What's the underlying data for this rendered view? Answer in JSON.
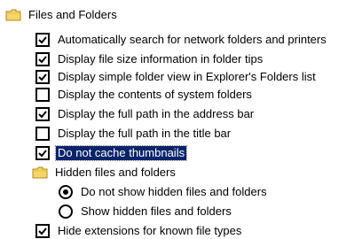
{
  "groups": [
    {
      "label": "Files and Folders",
      "icon": "folder-icon",
      "items": [
        {
          "label": "Automatically search for network folders and printers",
          "checked": true
        },
        {
          "label": "Display file size information in folder tips",
          "checked": true
        },
        {
          "label": "Display simple folder view in Explorer's Folders list",
          "checked": true
        },
        {
          "label": "Display the contents of system folders",
          "checked": false
        },
        {
          "label": "Display the full path in the address bar",
          "checked": true
        },
        {
          "label": "Display the full path in the title bar",
          "checked": false
        },
        {
          "label": "Do not cache thumbnails",
          "checked": true,
          "selected": true
        }
      ],
      "subgroup": {
        "label": "Hidden files and folders",
        "icon": "folder-icon",
        "options": [
          {
            "label": "Do not show hidden files and folders",
            "selected": true
          },
          {
            "label": "Show hidden files and folders",
            "selected": false
          }
        ]
      },
      "after": [
        {
          "label": "Hide extensions for known file types",
          "checked": true
        }
      ]
    }
  ],
  "colors": {
    "selection_bg": "#0a246a",
    "selection_fg": "#ffffff",
    "folder_fill": "#f4d56a",
    "folder_stroke": "#b08a1a"
  }
}
